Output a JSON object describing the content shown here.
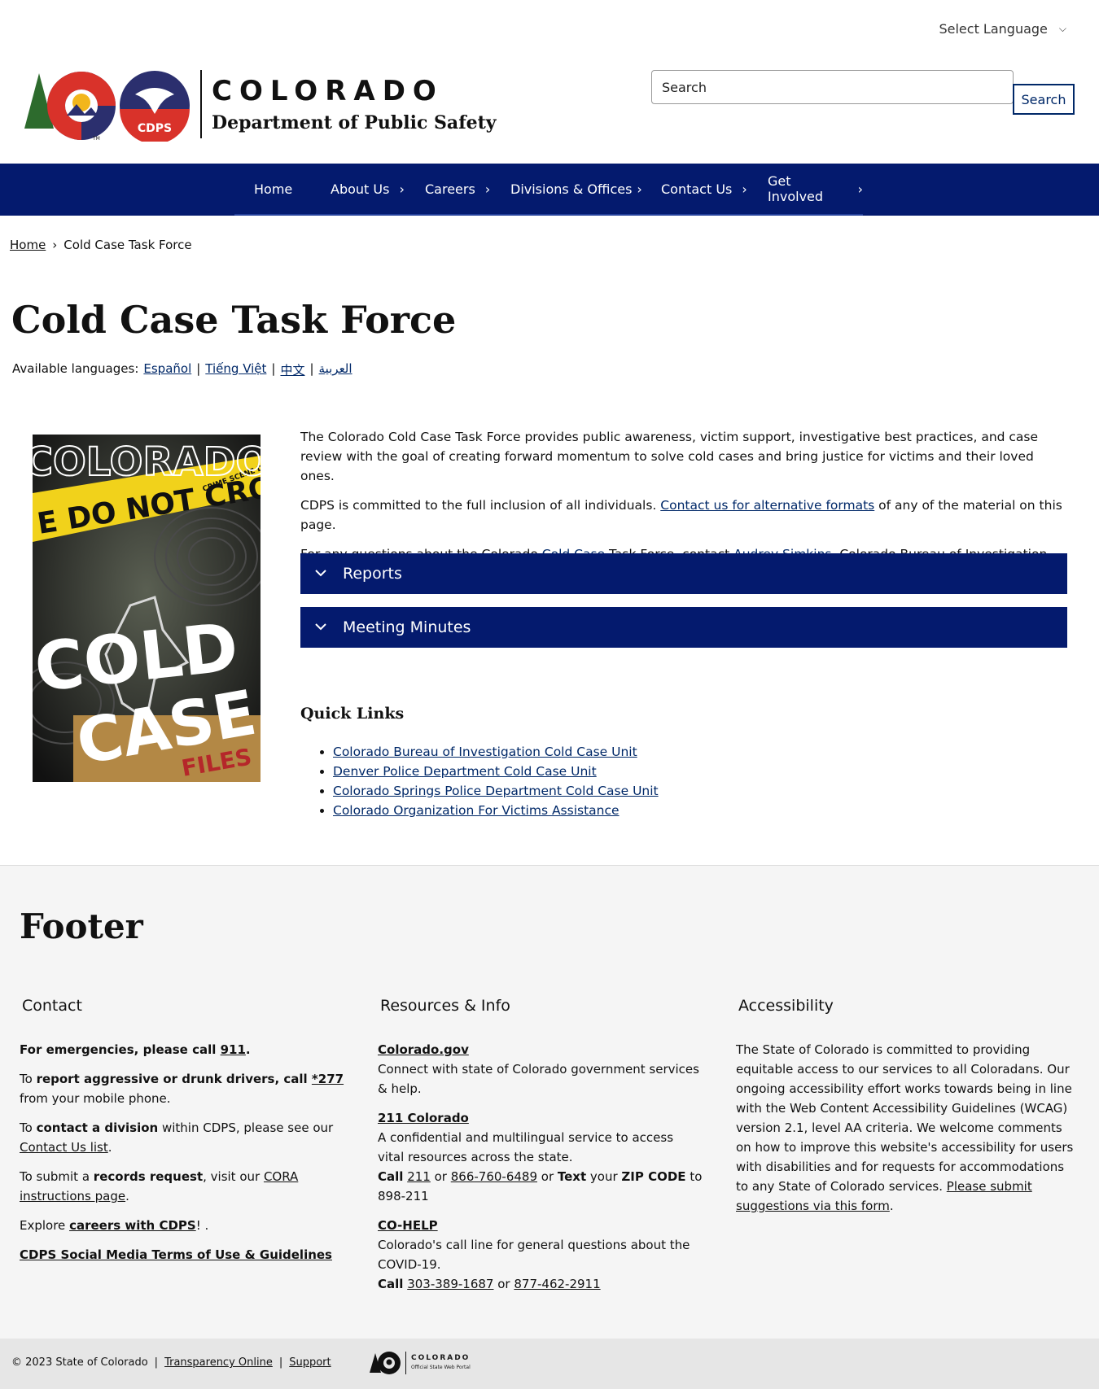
{
  "language_select": {
    "label": "Select Language"
  },
  "header": {
    "title": "COLORADO",
    "subtitle": "Department of Public Safety",
    "cdps_badge": "CDPS",
    "tm": "TM"
  },
  "search": {
    "placeholder": "Search",
    "value": "Search",
    "button_label": "Search"
  },
  "nav": {
    "items": [
      {
        "label": "Home",
        "has_arrow": false
      },
      {
        "label": "About Us",
        "has_arrow": true
      },
      {
        "label": "Careers",
        "has_arrow": true
      },
      {
        "label": "Divisions & Offices",
        "has_arrow": true
      },
      {
        "label": "Contact Us",
        "has_arrow": true
      },
      {
        "label": "Get Involved",
        "has_arrow": true
      }
    ]
  },
  "breadcrumb": {
    "home": "Home",
    "separator": "›",
    "current": "Cold Case Task Force"
  },
  "page": {
    "title": "Cold Case Task Force",
    "available_languages_label": "Available languages:",
    "languages": [
      "Español ",
      "Tiếng Việt",
      "中文",
      "العربية"
    ]
  },
  "hero_image": {
    "alt": "Colorado Cold Case Files poster",
    "line1": "COLORADO",
    "tape": "E DO NOT CROSS",
    "tape_small": "CRIME SCENE DO",
    "line2": "COLD",
    "line3": "CASE",
    "line4": "FILES"
  },
  "content": {
    "p1": "The Colorado Cold Case Task Force provides public awareness, victim support, investigative best practices, and case review with the goal of creating forward momentum to solve cold cases and bring justice for victims and their loved ones.",
    "p2_before": "CDPS is committed to the full inclusion of all individuals. ",
    "p2_link": "Contact us for alternative formats",
    "p2_after": " of any of the material on this page.",
    "p3_before": "For any questions about the Colorado ",
    "p3_link1": "Cold Case",
    "p3_mid": " Task Force, contact ",
    "p3_link2": "Audrey Simkins",
    "p3_after": ", Colorado Bureau of Investigation."
  },
  "accordions": [
    {
      "label": "Reports"
    },
    {
      "label": "Meeting Minutes"
    }
  ],
  "quick_links": {
    "title": "Quick Links",
    "items": [
      "Colorado Bureau of Investigation Cold Case Unit",
      "Denver Police Department Cold Case Unit",
      "Colorado Springs Police Department Cold Case Unit",
      "Colorado Organization For Victims Assistance"
    ]
  },
  "footer": {
    "title": "Footer",
    "contact": {
      "heading": "Contact",
      "emergency_before": "For emergencies, please call ",
      "emergency_link": "911",
      "emergency_after": ".",
      "drivers_a": "To ",
      "drivers_b": "report aggressive or drunk drivers, call ",
      "drivers_link": "*277",
      "drivers_c": " from your mobile phone.",
      "division_a": "To ",
      "division_b": "contact a division",
      "division_c": " within CDPS, please see our ",
      "division_link": "Contact Us list",
      "division_d": ".",
      "records_a": "To submit a ",
      "records_b": "records request",
      "records_c": ", visit our ",
      "records_link": "CORA instructions page",
      "records_d": ".",
      "careers_a": "Explore ",
      "careers_link": "careers with CDPS",
      "careers_b": "! .",
      "social_link": "CDPS Social Media Terms of Use & Guidelines"
    },
    "resources": {
      "heading": "Resources & Info",
      "cogov_link": "Colorado.gov",
      "cogov_desc": "Connect with state of Colorado government services & help.",
      "co211_link": "211 Colorado",
      "co211_desc": "A confidential and multilingual service to access vital resources across the state.",
      "call": "Call",
      "co211_num1": "211",
      "or": " or ",
      "co211_num2": "866-760-6489",
      "text": "Text",
      "your": " your ",
      "zip": "ZIP CODE",
      "to_num": " to 898-211",
      "cohelp_link": "CO-HELP",
      "cohelp_desc": "Colorado's call line for general questions about the COVID-19.",
      "cohelp_num1": "303-389-1687",
      "cohelp_num2": "877-462-2911"
    },
    "accessibility": {
      "heading": "Accessibility",
      "text": "The State of Colorado is committed to providing equitable access to our services to all Coloradans. Our ongoing accessibility effort works towards being in line with the Web Content Accessibility Guidelines (WCAG) version 2.1, level AA criteria. We welcome comments on how to improve this website's accessibility for users with disabilities and for requests for accommodations to any State of Colorado services. ",
      "link": "Please submit suggestions via this form",
      "after": "."
    }
  },
  "bottom_bar": {
    "copyright": "© 2023 State of Colorado",
    "sep": "|",
    "transparency": "Transparency Online",
    "support": "Support",
    "portal_title": "COLORADO",
    "portal_sub": "Official State Web Portal"
  },
  "colors": {
    "navy": "#041a6e",
    "link": "#002868",
    "footer_bg": "#f5f5f5"
  }
}
